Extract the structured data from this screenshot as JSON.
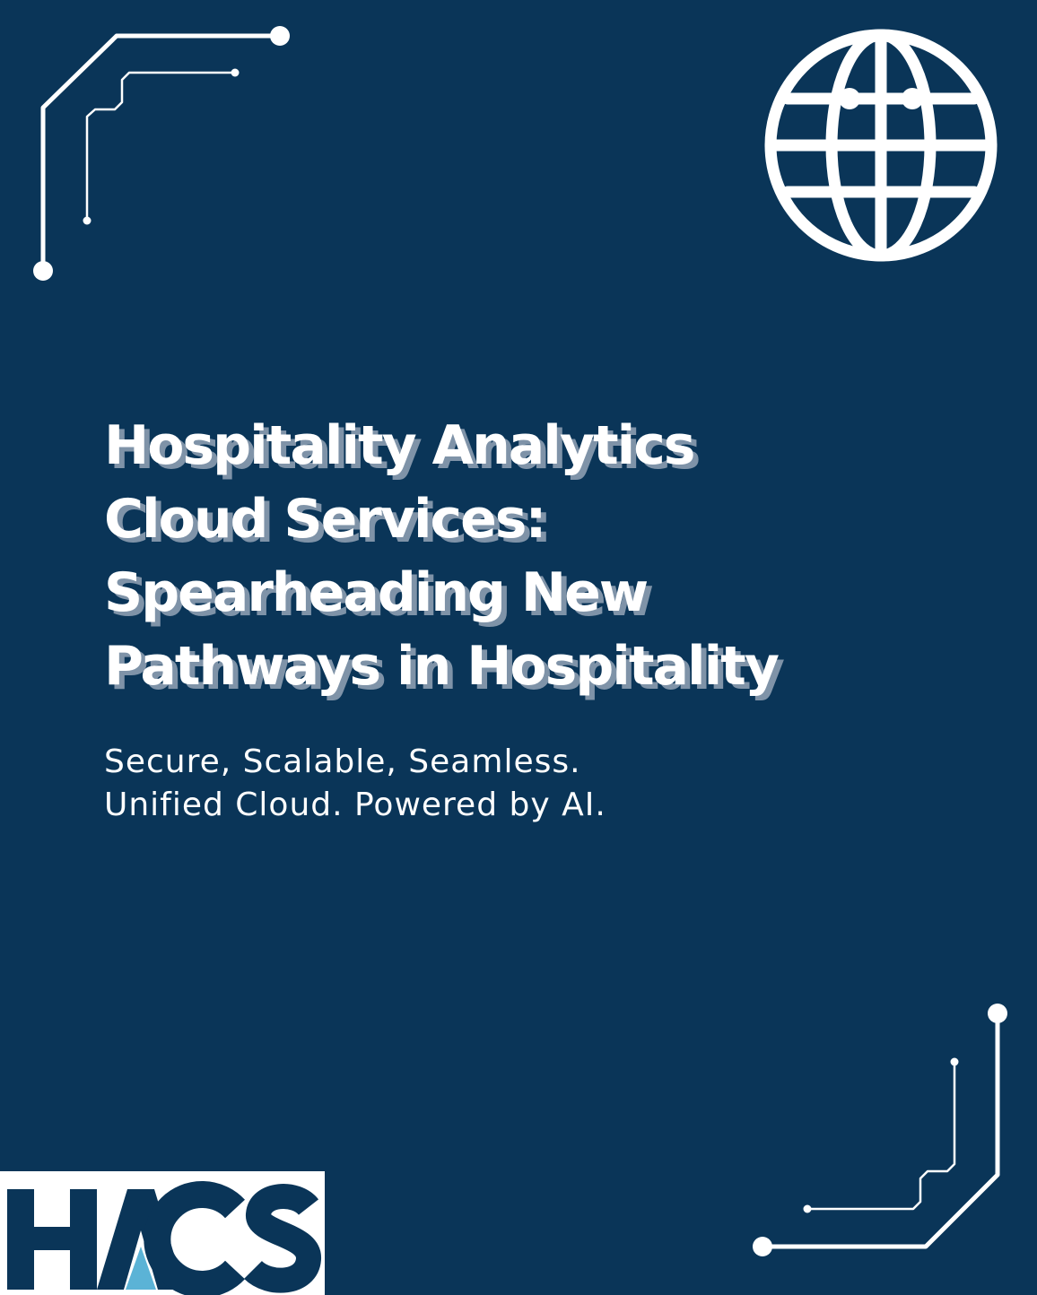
{
  "headline": {
    "lines": [
      "Hospitality Analytics",
      "Cloud Services:",
      "Spearheading New",
      "Pathways in Hospitality"
    ]
  },
  "tagline": {
    "lines": [
      "Secure, Scalable, Seamless.",
      "Unified Cloud. Powered by AI."
    ]
  },
  "logo": {
    "text": "HACS"
  },
  "icons": {
    "globe": "globe-icon",
    "circuit_top_left": "circuit-lines-icon",
    "circuit_bottom_right": "circuit-lines-icon"
  },
  "colors": {
    "background": "#0a3558",
    "text": "#ffffff",
    "headline_shadow": "#7f93a8",
    "logo_navy": "#0a3558",
    "logo_accent": "#5bb3d6"
  }
}
